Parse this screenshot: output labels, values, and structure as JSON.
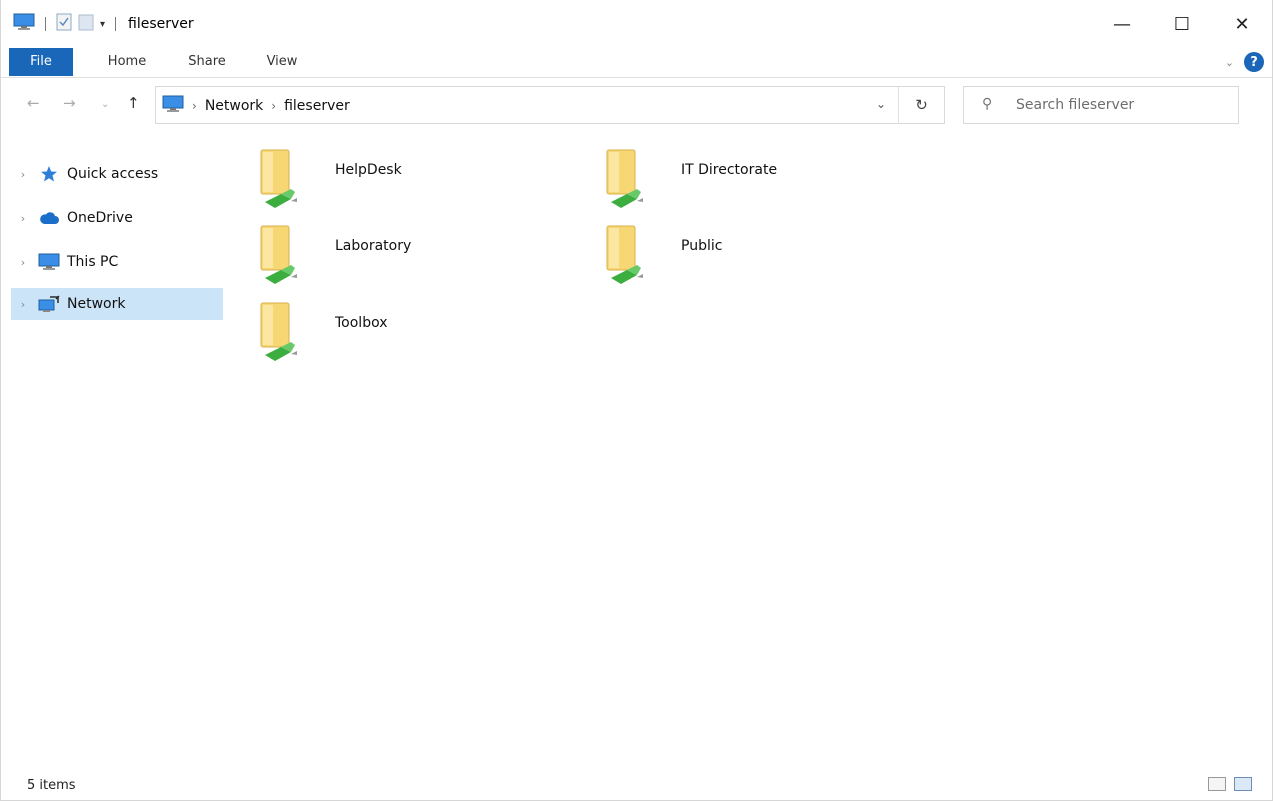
{
  "window": {
    "title": "fileserver"
  },
  "window_controls": {
    "minimize": "—",
    "maximize": "☐",
    "close": "✕"
  },
  "ribbon": {
    "tabs": [
      "File",
      "Home",
      "Share",
      "View"
    ],
    "help_label": "?"
  },
  "address": {
    "crumbs": [
      "Network",
      "fileserver"
    ]
  },
  "search": {
    "placeholder": "Search fileserver"
  },
  "nav_pane": {
    "items": [
      {
        "label": "Quick access",
        "icon": "star-icon"
      },
      {
        "label": "OneDrive",
        "icon": "cloud-icon"
      },
      {
        "label": "This PC",
        "icon": "computer-icon"
      },
      {
        "label": "Network",
        "icon": "network-icon",
        "selected": true
      }
    ]
  },
  "content": {
    "folders": [
      {
        "name": "HelpDesk"
      },
      {
        "name": "IT Directorate"
      },
      {
        "name": "Laboratory"
      },
      {
        "name": "Public"
      },
      {
        "name": "Toolbox"
      }
    ]
  },
  "status": {
    "item_count": "5 items"
  },
  "colors": {
    "accent": "#1a66b8",
    "selection": "#cce4f7",
    "folder": "#f7d774",
    "share_green": "#3cae3f"
  }
}
